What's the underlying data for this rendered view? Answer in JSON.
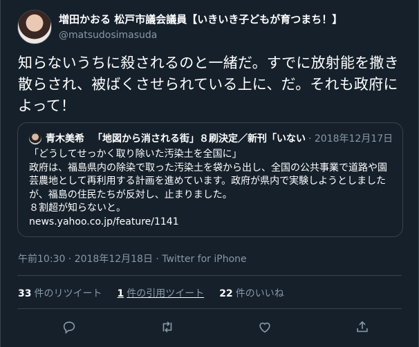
{
  "author": {
    "display_name": "増田かおる 松戸市議会議員【いきいき子どもが育つまち！】",
    "handle": "@matsudosimasuda"
  },
  "tweet": {
    "text": "知らないうちに殺されるのと一緒だ。すでに放射能を撒き散らされ、被ばくさせられている上に、だ。それも政府によって！"
  },
  "quote": {
    "name": "青木美希",
    "title": "「地図から消される街」８刷決定／新刊「いない",
    "date": "· 2018年12月17日",
    "body": "「どうしてせっかく取り除いた汚染土を全国に」\n政府は、福島県内の除染で取った汚染土を袋から出し、全国の公共事業で道路や園芸農地として再利用する計画を進めています。政府が県内で実験しようとしましたが、福島の住民たちが反対し、止まりました。\n８割超が知らないと。\nnews.yahoo.co.jp/feature/1141"
  },
  "meta": {
    "timestamp": "午前10:30 · 2018年12月18日 · Twitter for iPhone"
  },
  "stats": {
    "retweets_count": "33",
    "retweets_label": "件のリツイート",
    "quotes_count": "1",
    "quotes_label": "件の引用ツイート",
    "likes_count": "22",
    "likes_label": "件のいいね"
  },
  "icons": [
    "reply-icon",
    "retweet-icon",
    "like-icon",
    "share-icon"
  ]
}
